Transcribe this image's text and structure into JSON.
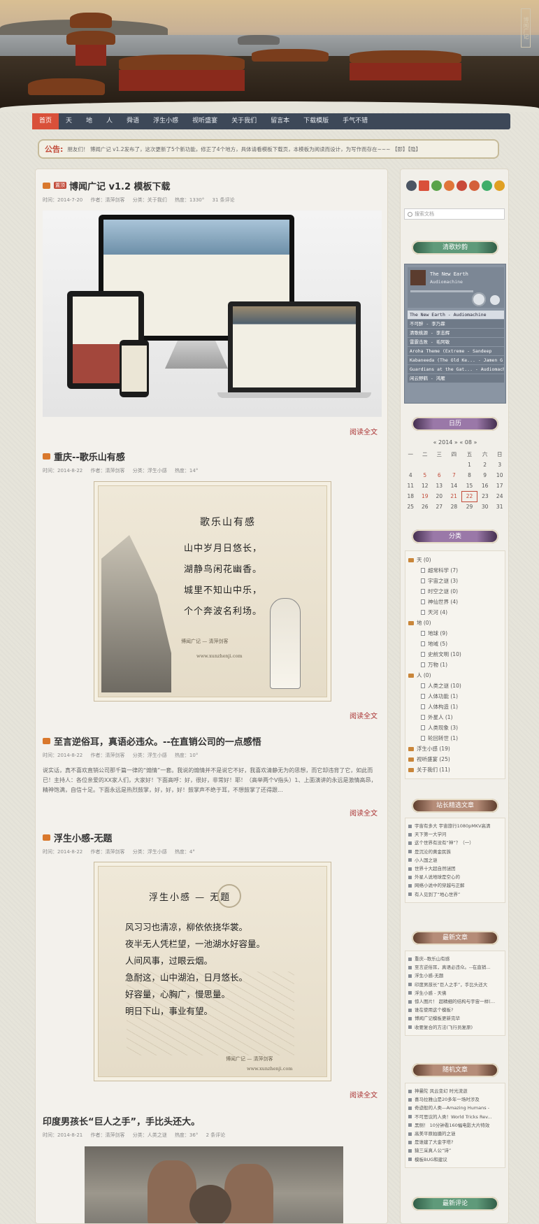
{
  "banner": {
    "side_stamp": "博闻广记"
  },
  "nav": {
    "items": [
      "首页",
      "天",
      "地",
      "人",
      "舜语",
      "浮生小感",
      "视听盛宴",
      "关于我们",
      "留言本",
      "下载模版",
      "手气不错"
    ]
  },
  "notice": {
    "label": "公告:",
    "text": "朋友们！ 博闻广记 v1.2发布了，这次更新了5个新功能，修正了4个地方，具体请看模板下载页，本模板为阅读而设计，为写作而存在~~~ 【即】【隐】"
  },
  "posts": [
    {
      "title": "博闻广记 v1.2 模板下载",
      "tag": "置顶",
      "meta": {
        "time": "时间：2014-7-20",
        "author": "作者：清萍剑客",
        "cat": "分类：关于我们",
        "hot": "热度：1330°",
        "comments": "31 条评论"
      }
    },
    {
      "title": "重庆--歌乐山有感",
      "meta": {
        "time": "时间：2014-8-22",
        "author": "作者：清萍剑客",
        "cat": "分类：浮生小感",
        "hot": "热度：14°"
      },
      "poem_title": "歌乐山有感",
      "poem": "山中岁月日悠长，\n湖静鸟闲花幽香。\n城里不知山中乐，\n个个奔波名利场。",
      "sign": "博闻广记 — 清萍剑客",
      "site": "www.xunzhenji.com"
    },
    {
      "title": "至言逆俗耳，真语必违众。--在直销公司的一点感悟",
      "meta": {
        "time": "时间：2014-8-22",
        "author": "作者：清萍剑客",
        "cat": "分类：浮生小感",
        "hot": "热度：10°"
      },
      "excerpt": "说实话，真不喜欢直销公司那千篇一律的“煽情”一套。我说的煽情并不是说它不好，我喜欢清静无为的思想，而它却违背了它，如此而已！主持人：各位亲爱的XX家人们，大家好！下面高呼：好，很好，非常好！耶！（高举两个V指头）1、上面演讲的永远是激情高昂，精神饱满，自信十足。下面永远是热烈鼓掌，好，好，好！鼓掌声不绝于耳，不想鼓掌了还得跟..."
    },
    {
      "title": "浮生小感-无题",
      "meta": {
        "time": "时间：2014-8-22",
        "author": "作者：清萍剑客",
        "cat": "分类：浮生小感",
        "hot": "热度：4°"
      },
      "poem_title": "浮生小感 — 无题",
      "poem": "风习习也清凉，柳依依挠华裳。\n夜半无人凭栏望，一池湖水好容量。\n人间风事，过眼云烟。\n急耐这，山中湖泊，日月悠长。\n好容量，心胸广，慢思量。\n明日下山，事业有望。",
      "sign": "博闻广记 — 清萍剑客",
      "site": "www.xunzhenji.com"
    },
    {
      "title": "印度男孩长“巨人之手”，手比头还大。",
      "meta": {
        "time": "时间：2014-8-21",
        "author": "作者：清萍剑客",
        "cat": "分类：人类之谜",
        "hot": "热度：36°",
        "comments": "2 条评论"
      }
    }
  ],
  "read_more": "阅读全文",
  "sidebar": {
    "search_placeholder": "搜索文档",
    "w_music": "清歌妙韵",
    "player": {
      "title": "The New Earth",
      "artist": "Audiomachine",
      "list": [
        "The New Earth - Audiomachine",
        "不可醉 - 李乃霖",
        "清歌桃源 - 李志辉",
        "雷霆击败 - 毛阿敏",
        "Aroha Theme (Extreme - Sandeep",
        "Kabaneeda (The Old Ke... - Jamen G",
        "Guardians at the Gat... - Audiomachi",
        "闲云野鹤 - 鸿雁"
      ]
    },
    "w_calendar": "日历",
    "calendar": {
      "month": "« 2014 » « 08 »",
      "head": [
        "一",
        "二",
        "三",
        "四",
        "五",
        "六",
        "日"
      ],
      "rows": [
        [
          "",
          "",
          "",
          "",
          "1",
          "2",
          "3"
        ],
        [
          "4",
          "5",
          "6",
          "7",
          "8",
          "9",
          "10"
        ],
        [
          "11",
          "12",
          "13",
          "14",
          "15",
          "16",
          "17"
        ],
        [
          "18",
          "19",
          "20",
          "21",
          "22",
          "23",
          "24"
        ],
        [
          "25",
          "26",
          "27",
          "28",
          "29",
          "30",
          "31"
        ]
      ]
    },
    "w_cat": "分类",
    "categories": [
      {
        "name": "天 (0)",
        "sub": false
      },
      {
        "name": "超常科学 (7)",
        "sub": true
      },
      {
        "name": "宇宙之谜 (3)",
        "sub": true
      },
      {
        "name": "时空之谜 (0)",
        "sub": true
      },
      {
        "name": "神仙世界 (4)",
        "sub": true
      },
      {
        "name": "天河 (4)",
        "sub": true
      },
      {
        "name": "地 (0)",
        "sub": false
      },
      {
        "name": "地球 (9)",
        "sub": true
      },
      {
        "name": "地域 (5)",
        "sub": true
      },
      {
        "name": "史前文明 (10)",
        "sub": true
      },
      {
        "name": "万物 (1)",
        "sub": true
      },
      {
        "name": "人 (0)",
        "sub": false
      },
      {
        "name": "人类之谜 (10)",
        "sub": true
      },
      {
        "name": "人体功能 (1)",
        "sub": true
      },
      {
        "name": "人体构造 (1)",
        "sub": true
      },
      {
        "name": "外星人 (1)",
        "sub": true
      },
      {
        "name": "人类现象 (3)",
        "sub": true
      },
      {
        "name": "轮回转世 (1)",
        "sub": true
      },
      {
        "name": "浮生小感 (19)",
        "sub": false
      },
      {
        "name": "视听盛宴 (25)",
        "sub": false
      },
      {
        "name": "关于我们 (11)",
        "sub": false
      }
    ],
    "w_recommend": "站长精选文章",
    "recommend": [
      "宇宙有多大 宇宙旅行1080pMKV高清",
      "天下第一大学问",
      "这个世界有没有“神”？（一）",
      "是沉沦的黄金民族",
      "小人国之谜",
      "世界十大超自然谜团",
      "外星人说地球是空心的",
      "网络小说中的穿越与正解",
      "有人见到了“地心世界”"
    ],
    "w_new": "最新文章",
    "newest": [
      "重庆--歌乐山有感",
      "至言逆俗耳，真语必违众。--在直销...",
      "浮生小感-无题",
      "印度男孩长“巨人之手”，手比头还大",
      "浮生小感 - 天佛",
      "惊人图片！ 超精细的结构与宇宙一样(…",
      "谁在使用这个模板?",
      "博闻广记模板更新完毕",
      "收要复合的方法(飞行员复原)"
    ],
    "w_random": "随机文章",
    "random": [
      "神曼陀 风云变幻 时光流逝",
      "喜马拉雅山是20多年一场时涉及",
      "奇迹般的人类—Amazing Humans -",
      "不可思议的人类！World Tricks Rev...",
      "黑侧！ 10分钟看160幅电影大片特效",
      "高美平原拍摄的之谜",
      "是谁建了大金字塔?",
      "猿三采真人公“诗”",
      "模板BUG和建议"
    ],
    "w_comments": "最新评论"
  }
}
